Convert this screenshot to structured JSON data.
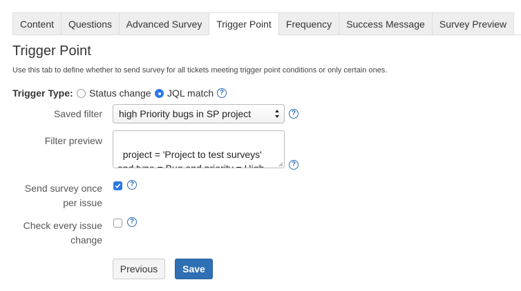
{
  "tabs": [
    {
      "label": "Content",
      "active": false
    },
    {
      "label": "Questions",
      "active": false
    },
    {
      "label": "Advanced Survey",
      "active": false
    },
    {
      "label": "Trigger Point",
      "active": true
    },
    {
      "label": "Frequency",
      "active": false
    },
    {
      "label": "Success Message",
      "active": false
    },
    {
      "label": "Survey Preview",
      "active": false
    }
  ],
  "page": {
    "title": "Trigger Point",
    "intro": "Use this tab to define whether to send survey for all tickets meeting trigger point conditions or only certain ones."
  },
  "trigger_type": {
    "label": "Trigger Type:",
    "options": [
      {
        "label": "Status change",
        "selected": false
      },
      {
        "label": "JQL match",
        "selected": true
      }
    ]
  },
  "saved_filter": {
    "label": "Saved filter",
    "value": "high Priority bugs in SP project"
  },
  "filter_preview": {
    "label": "Filter preview",
    "value": "project = 'Project to test surveys'\nand type = Bug and priority = High"
  },
  "send_once": {
    "label_line1": "Send survey once",
    "label_line2": "per issue",
    "checked": true
  },
  "check_every": {
    "label_line1": "Check every issue",
    "label_line2": "change",
    "checked": false
  },
  "buttons": {
    "previous": "Previous",
    "save": "Save"
  },
  "colors": {
    "accent": "#2b78e4",
    "save_button": "#2f6fb4",
    "help_icon": "#2b6cb0"
  },
  "icons": {
    "help": "question-circle-icon",
    "select": "select-arrows-icon",
    "check": "checkmark-icon"
  }
}
